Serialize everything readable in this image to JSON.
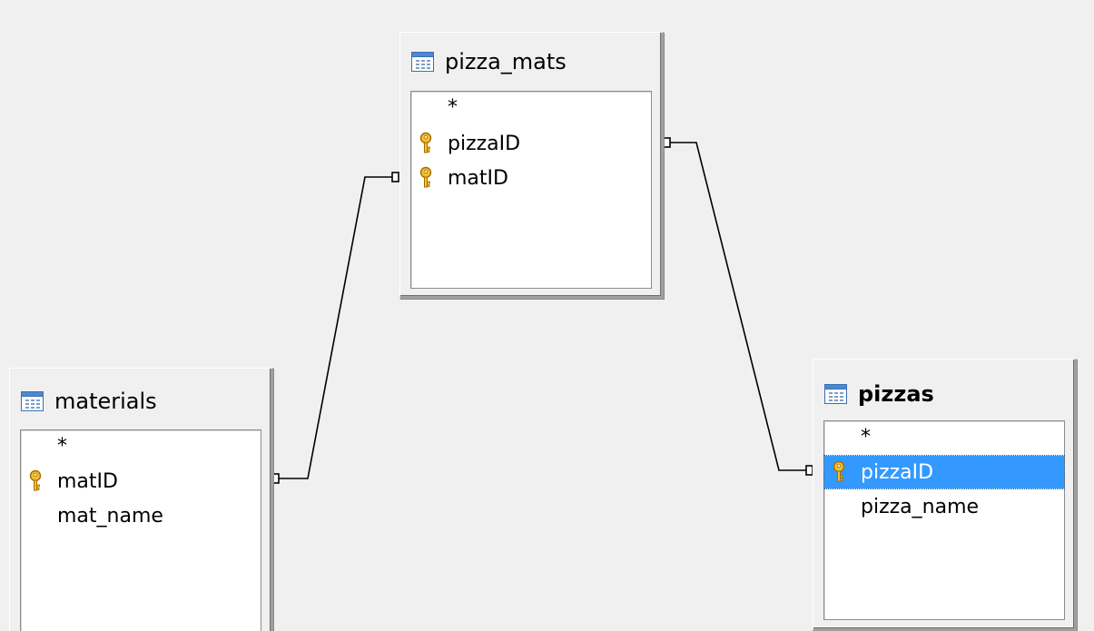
{
  "tables": {
    "pizza_mats": {
      "name": "pizza_mats",
      "icon": "table-icon",
      "fields": [
        {
          "label": "*",
          "key": false
        },
        {
          "label": "pizzaID",
          "key": true
        },
        {
          "label": "matID",
          "key": true
        }
      ]
    },
    "materials": {
      "name": "materials",
      "icon": "table-icon",
      "fields": [
        {
          "label": "*",
          "key": false
        },
        {
          "label": "matID",
          "key": true
        },
        {
          "label": "mat_name",
          "key": false
        }
      ]
    },
    "pizzas": {
      "name": "pizzas",
      "icon": "table-icon",
      "active": true,
      "fields": [
        {
          "label": "*",
          "key": false
        },
        {
          "label": "pizzaID",
          "key": true,
          "selected": true
        },
        {
          "label": "pizza_name",
          "key": false
        }
      ]
    }
  },
  "relations": [
    {
      "from": "materials.matID",
      "to": "pizza_mats.matID"
    },
    {
      "from": "pizza_mats.pizzaID",
      "to": "pizzas.pizzaID"
    }
  ],
  "colors": {
    "background": "#f0f0f0",
    "selection": "#3399ff",
    "key_icon": "#e8a217",
    "connector": "#000000"
  }
}
